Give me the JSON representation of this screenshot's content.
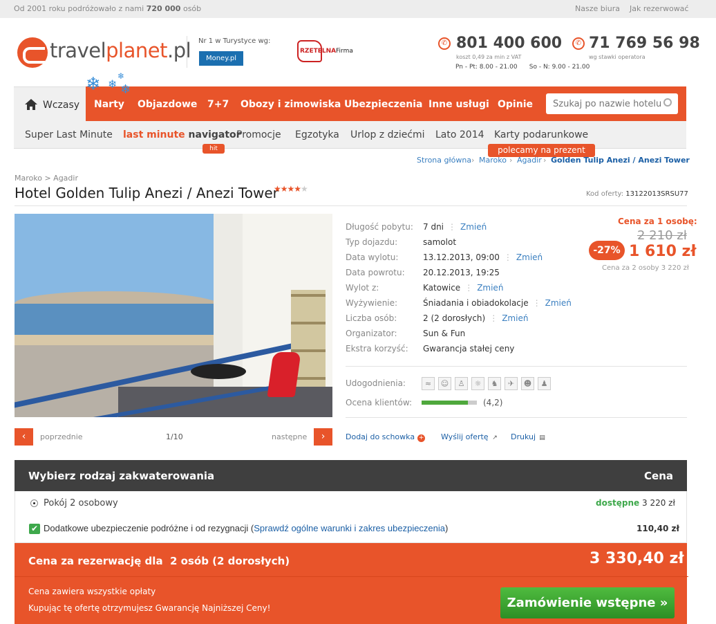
{
  "topbar": {
    "since_prefix": "Od 2001 roku podróżowało z nami",
    "since_count": "720 000",
    "since_suffix": "osób",
    "link_offices": "Nasze biura",
    "link_howto": "Jak rezerwować"
  },
  "header": {
    "logo_part1": "travel",
    "logo_part2": "planet",
    "logo_part3": ".pl",
    "award_label": "Nr 1 w Turystyce wg:",
    "award_badge": "Money.pl",
    "rzetelna_1": "RZETELNA",
    "rzetelna_2": "Firma",
    "phone1": "801 400 600",
    "phone1_note": "koszt 0,49 za min z VAT",
    "hours_weekday": "Pn - Pt: 8.00 - 21.00",
    "hours_weekend": "So - N: 9.00 - 21.00",
    "phone2": "71 769 56 98",
    "phone2_note": "wg stawki operatora"
  },
  "nav": {
    "home": "Wczasy",
    "items": [
      "Narty",
      "Objazdowe",
      "7+7",
      "Obozy i zimowiska",
      "Ubezpieczenia",
      "Inne usługi",
      "Opinie"
    ],
    "search_placeholder": "Szukaj po nazwie hotelu"
  },
  "subnav": {
    "items": [
      "Super Last Minute",
      "Promocje",
      "Egzotyka",
      "Urlop z dziećmi",
      "Lato 2014",
      "Karty podarunkowe"
    ],
    "lmn_a": "last minute",
    "lmn_b": "navigator",
    "hit": "hit",
    "prezent": "polecamy na prezent"
  },
  "breadcrumb": {
    "items": [
      "Strona główna",
      "Maroko",
      "Agadir"
    ],
    "current": "Golden Tulip Anezi / Anezi Tower",
    "sep": "›"
  },
  "hotel": {
    "location_country": "Maroko",
    "location_city": "Agadir",
    "location_sep": ">",
    "title": "Hotel Golden Tulip Anezi / Anezi Tower",
    "stars_on": "★★★★",
    "stars_off": "★",
    "stars": 4,
    "offer_code_label": "Kod oferty:",
    "offer_code": "13122013SRSU77"
  },
  "gallery": {
    "prev": "poprzednie",
    "next": "następne",
    "counter": "1/10"
  },
  "details": {
    "change": "Zmień",
    "rows": [
      {
        "label": "Długość pobytu:",
        "value": "7 dni"
      },
      {
        "label": "Typ dojazdu:",
        "value": "samolot"
      },
      {
        "label": "Data wylotu:",
        "value": "13.12.2013, 09:00"
      },
      {
        "label": "Data powrotu:",
        "value": "20.12.2013, 19:25"
      },
      {
        "label": "Wylot z:",
        "value": "Katowice"
      },
      {
        "label": "Wyżywienie:",
        "value": "Śniadania i obiadokolacje"
      },
      {
        "label": "Liczba osób:",
        "value": "2 (2 dorosłych)"
      },
      {
        "label": "Organizator:",
        "value": "Sun & Fun"
      },
      {
        "label": "Ekstra korzyść:",
        "value": "Gwarancja stałej ceny"
      }
    ],
    "amenities_label": "Udogodnienia:",
    "amenities": [
      "pool-icon",
      "family-icon",
      "fitness-icon",
      "beach-icon",
      "kids-icon",
      "plane-icon",
      "theatre-icon",
      "sport-icon"
    ],
    "rating_label": "Ocena klientów:",
    "rating_value": "(4,2)",
    "rating_fraction": 0.84
  },
  "actions": {
    "clipboard": "Dodaj do schowka",
    "send": "Wyślij ofertę",
    "print": "Drukuj"
  },
  "price": {
    "label": "Cena za 1 osobę:",
    "old": "2 210 zł",
    "discount": "-27%",
    "new": "1 610 zł",
    "for_two": "Cena za 2 osoby 3 220 zł"
  },
  "accommodation": {
    "header": "Wybierz rodzaj zakwaterowania",
    "price_header": "Cena",
    "room": "Pokój 2 osobowy",
    "room_status": "dostępne",
    "room_price": "3 220 zł",
    "insurance_pre": "Dodatkowe ubezpieczenie podróżne i od rezygnacji (",
    "insurance_link": "Sprawdź ogólne warunki i zakres ubezpieczenia",
    "insurance_post": ")",
    "insurance_price": "110,40 zł"
  },
  "summary": {
    "label": "Cena za rezerwację dla  2 osób (2 dorosłych)",
    "total": "3 330,40 zł",
    "note1": "Cena zawiera wszystkie opłaty",
    "note2": "Kupując tę ofertę otrzymujesz Gwarancję Najniższej Ceny!",
    "button": "Zamówienie wstępne »"
  },
  "colors": {
    "accent": "#e8542a",
    "link": "#1b5fa5",
    "ok": "#3ea84b",
    "dark": "#3f3f3f"
  }
}
